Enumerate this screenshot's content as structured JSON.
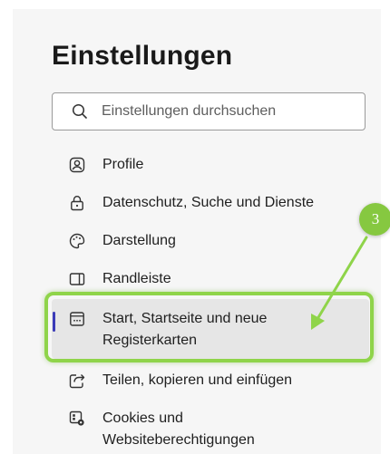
{
  "title": "Einstellungen",
  "search": {
    "placeholder": "Einstellungen durchsuchen"
  },
  "menu": {
    "items": [
      {
        "label": "Profile",
        "icon": "profile-icon"
      },
      {
        "label": "Datenschutz, Suche und Dienste",
        "icon": "lock-icon"
      },
      {
        "label": "Darstellung",
        "icon": "palette-icon"
      },
      {
        "label": "Randleiste",
        "icon": "sidebar-icon"
      },
      {
        "label": "Start, Startseite und neue Registerkarten",
        "line1": "Start, Startseite und neue",
        "line2": "Registerkarten",
        "icon": "start-page-icon",
        "selected": true
      },
      {
        "label": "Teilen, kopieren und einfügen",
        "icon": "share-icon"
      },
      {
        "label": "Cookies und Websiteberechtigungen",
        "line1": "Cookies und",
        "line2": "Websiteberechtigungen",
        "icon": "cookies-permissions-icon"
      }
    ]
  },
  "annotation": {
    "step": "3",
    "color": "#86c840"
  },
  "colors": {
    "selection_bar": "#3b3bb8",
    "highlight": "#8fd44a"
  }
}
